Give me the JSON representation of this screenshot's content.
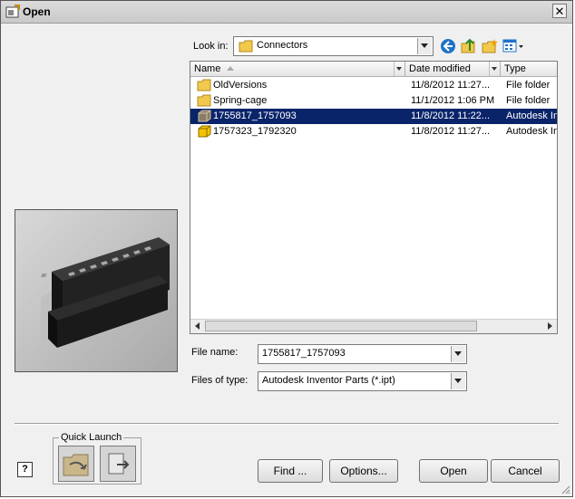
{
  "window": {
    "title": "Open",
    "close_glyph": "✕"
  },
  "look_in": {
    "label": "Look in:",
    "value": "Connectors"
  },
  "toolbar": {
    "back_icon": "back-icon",
    "up_icon": "up-folder-icon",
    "new_folder_icon": "new-folder-icon",
    "views_icon": "views-menu-icon"
  },
  "list": {
    "columns": {
      "name": "Name",
      "date": "Date modified",
      "type": "Type"
    },
    "rows": [
      {
        "name": "OldVersions",
        "date": "11/8/2012 11:27...",
        "type": "File folder",
        "icon": "folder-icon"
      },
      {
        "name": "Spring-cage",
        "date": "11/1/2012 1:06 PM",
        "type": "File folder",
        "icon": "folder-icon"
      },
      {
        "name": "1755817_1757093",
        "date": "11/8/2012 11:22...",
        "type": "Autodesk Inv",
        "icon": "part-file-icon"
      },
      {
        "name": "1757323_1792320",
        "date": "11/8/2012 11:27...",
        "type": "Autodesk Inv",
        "icon": "part-file-icon"
      }
    ]
  },
  "file_name": {
    "label": "File name:",
    "value": "1755817_1757093"
  },
  "file_type": {
    "label": "Files of type:",
    "value": "Autodesk Inventor Parts (*.ipt)"
  },
  "quick_launch": {
    "label": "Quick Launch"
  },
  "buttons": {
    "find": "Find ...",
    "options": "Options...",
    "open": "Open",
    "cancel": "Cancel",
    "help": "?"
  },
  "colors": {
    "selection": "#0a246a",
    "folder": "#f2c94c",
    "accent_blue": "#1e73c9"
  }
}
